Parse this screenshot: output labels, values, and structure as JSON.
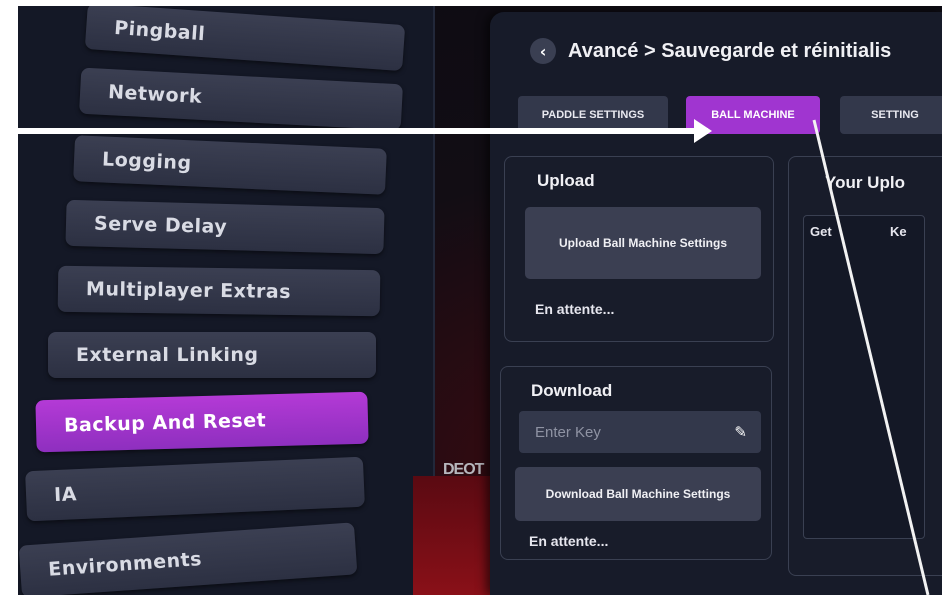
{
  "menu": [
    {
      "label": "Pingball"
    },
    {
      "label": "Network"
    },
    {
      "label": "Logging"
    },
    {
      "label": "Serve Delay"
    },
    {
      "label": "Multiplayer Extras"
    },
    {
      "label": "External Linking"
    },
    {
      "label": "Backup And Reset",
      "active": true
    },
    {
      "label": "IA"
    },
    {
      "label": "Environments"
    }
  ],
  "breadcrumb": "Avancé > Sauvegarde et réinitialis",
  "tabs": [
    {
      "label": "PADDLE SETTINGS"
    },
    {
      "label": "BALL MACHINE",
      "active": true
    },
    {
      "label": "SETTING"
    }
  ],
  "upload": {
    "title": "Upload",
    "button": "Upload Ball Machine Settings",
    "status": "En attente..."
  },
  "download": {
    "title": "Download",
    "key_placeholder": "Enter Key",
    "button": "Download Ball Machine Settings",
    "status": "En attente..."
  },
  "uploads": {
    "title": "Your Uplo",
    "col_get": "Get",
    "col_key": "Ke"
  },
  "backdrop_text": "DEOT",
  "colors": {
    "accent": "#a035d0",
    "panel": "#171b29",
    "button": "#3b3f52"
  }
}
